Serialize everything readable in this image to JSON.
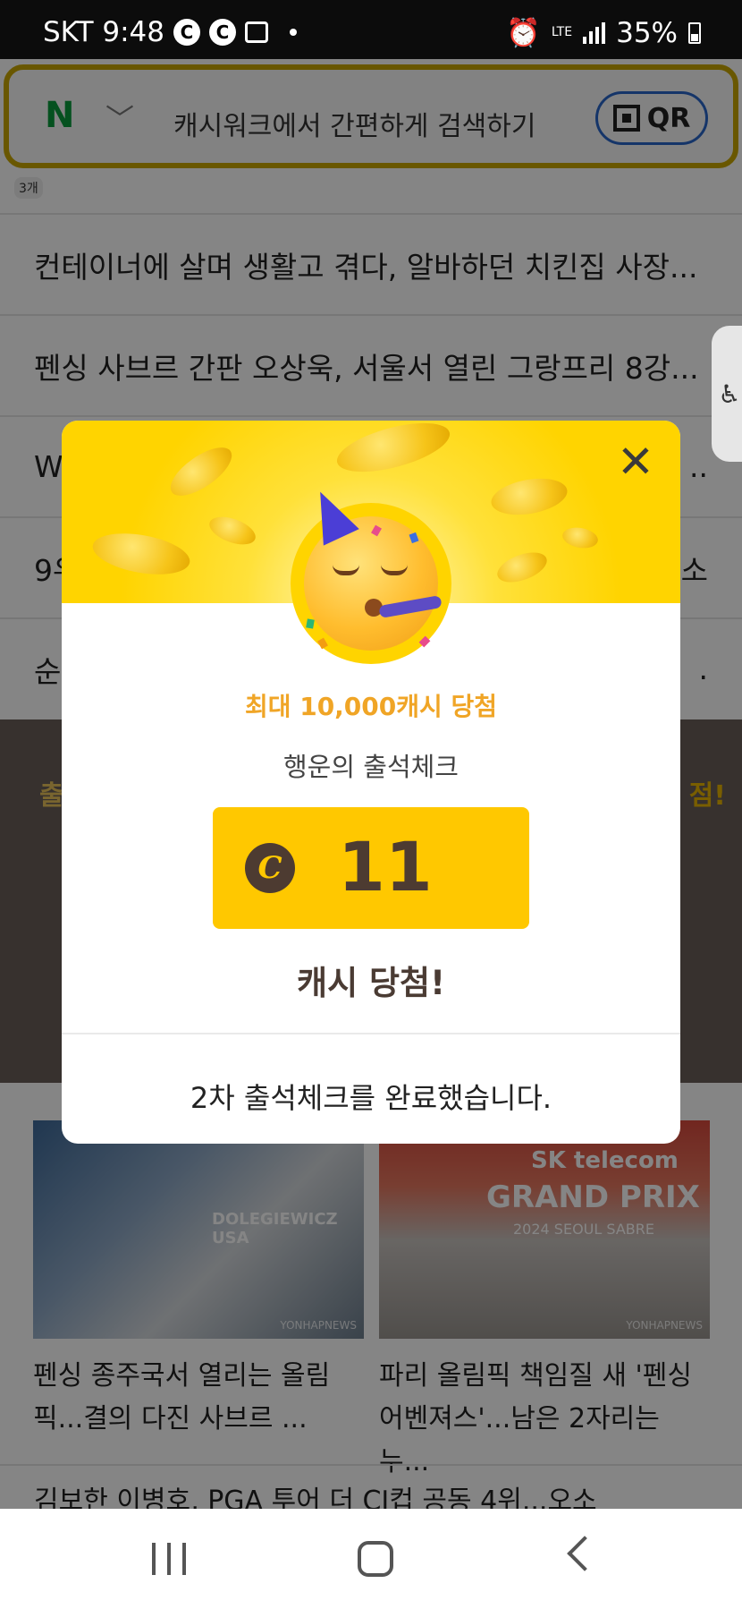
{
  "status_bar": {
    "carrier_time": "SKT 9:48",
    "notif_c1": "C",
    "notif_c2": "C",
    "network": "LTE",
    "battery": "35%"
  },
  "search": {
    "logo": "N",
    "placeholder": "캐시워크에서 간편하게 검색하기",
    "qr_label": "QR"
  },
  "count_badge": "3개",
  "news": [
    "컨테이너에 살며 생활고 겪다, 알바하던 치킨집 사장...",
    "펜싱 사브르 간판 오상욱, 서울서 열린 그랑프리 8강...",
    "W",
    "9우",
    "순"
  ],
  "news_tails": [
    "",
    "",
    "..",
    "소",
    "."
  ],
  "dark_band": {
    "left_text": "출",
    "right_text": "점!"
  },
  "photos": {
    "p1_jersey": "DOLEGIEWICZ USA",
    "p1_credit": "YONHAPNEWS",
    "p2_brand": "SK telecom",
    "p2_title": "GRAND PRIX",
    "p2_sub": "2024 SEOUL SABRE",
    "p2_credit": "YONHAPNEWS"
  },
  "captions": [
    "펜싱 종주국서 열리는 올림픽...결의 다진 사브르 ...",
    "파리 올림픽 책임질 새 '펜싱 어벤져스'...남은 2자리는 누..."
  ],
  "bottom_teaser": "김보한 이병호, PGA 투어 더 CJ컵 공동 4위...오소",
  "modal": {
    "close": "✕",
    "headline": "최대 10,000캐시 당첨",
    "subtitle": "행운의 출석체크",
    "coin_symbol": "C",
    "amount": "11",
    "win_text": "캐시 당첨!",
    "done_text": "2차 출석체크를 완료했습니다."
  },
  "colors": {
    "accent_yellow": "#ffd400",
    "headline_orange": "#f0a526",
    "brown": "#4d3b31"
  }
}
